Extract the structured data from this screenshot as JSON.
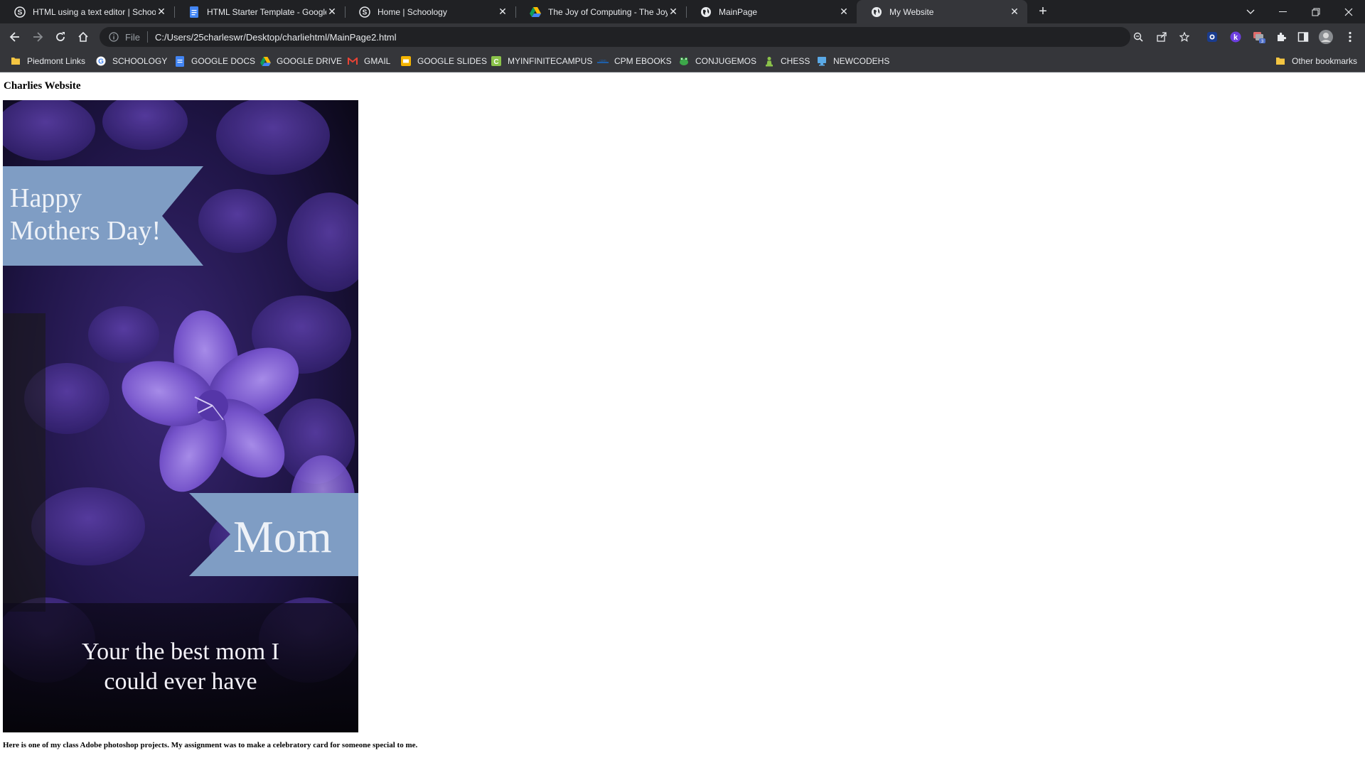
{
  "browser": {
    "tabs": [
      {
        "title": "HTML using a text editor | Schoology",
        "icon": "schoology-icon",
        "active": false
      },
      {
        "title": "HTML Starter Template - Google Docs",
        "icon": "google-docs-icon",
        "active": false
      },
      {
        "title": "Home | Schoology",
        "icon": "schoology-icon",
        "active": false
      },
      {
        "title": "The Joy of Computing - The Joy of Computing",
        "icon": "google-drive-icon",
        "active": false
      },
      {
        "title": "MainPage",
        "icon": "globe-icon",
        "active": false
      },
      {
        "title": "My Website",
        "icon": "globe-icon",
        "active": true
      }
    ],
    "new_tab_label": "+",
    "address": {
      "scheme_label": "File",
      "url": "C:/Users/25charleswr/Desktop/charliehtml/MainPage2.html"
    },
    "extension_badge": "3",
    "bookmarks": [
      {
        "label": "Piedmont Links",
        "icon": "folder-icon"
      },
      {
        "label": "SCHOOLOGY",
        "icon": "google-icon"
      },
      {
        "label": "GOOGLE DOCS",
        "icon": "google-docs-icon"
      },
      {
        "label": "GOOGLE DRIVE",
        "icon": "google-drive-icon"
      },
      {
        "label": "GMAIL",
        "icon": "gmail-icon"
      },
      {
        "label": "GOOGLE SLIDES",
        "icon": "google-slides-icon"
      },
      {
        "label": "MYINFINITECAMPUS",
        "icon": "campus-icon"
      },
      {
        "label": "CPM EBOOKS",
        "icon": "cpm-icon"
      },
      {
        "label": "CONJUGEMOS",
        "icon": "frog-icon"
      },
      {
        "label": "CHESS",
        "icon": "chess-pawn-icon"
      },
      {
        "label": "NEWCODEHS",
        "icon": "monitor-icon"
      }
    ],
    "other_bookmarks": "Other bookmarks"
  },
  "page": {
    "heading": "Charlies Website",
    "card": {
      "banner_line1": "Happy",
      "banner_line2": "Mothers Day!",
      "mom_label": "Mom",
      "message_line1": "Your the best mom I",
      "message_line2": "could ever have"
    },
    "caption": "Here is one of my class Adobe photoshop projects. My assignment was to make a celebratory card for someone special to me."
  },
  "colors": {
    "tab_strip": "#202124",
    "toolbar": "#35363a",
    "banner_blue": "#7f9dc4",
    "flower_purple": "#6a4bb8",
    "card_dark": "#120d22"
  }
}
